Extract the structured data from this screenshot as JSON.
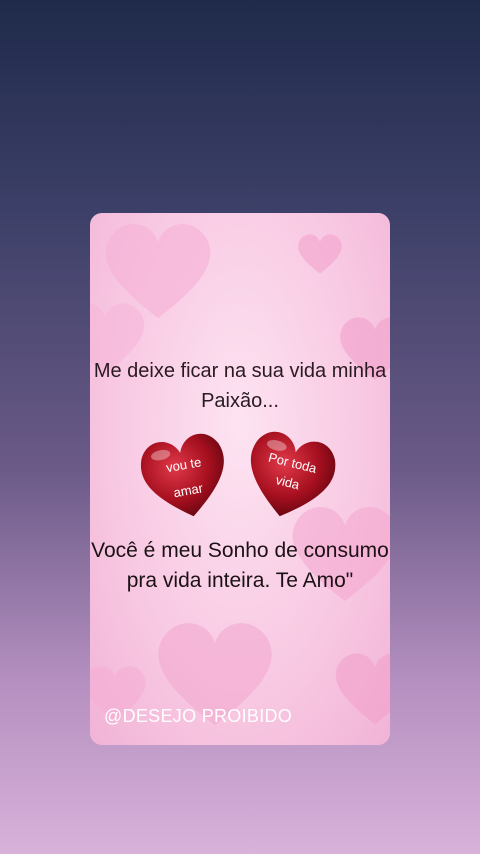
{
  "text": {
    "line1": "Me deixe ficar na sua vida minha Paixão...",
    "line2": "Você é meu Sonho de consumo pra vida inteira. Te Amo\"",
    "signature": "@DESEJO PROIBIDO"
  },
  "hearts": [
    {
      "label_line1": "vou te",
      "label_line2": "amar",
      "color": "#a50f1e"
    },
    {
      "label_line1": "Por toda",
      "label_line2": "vida",
      "color": "#a50f1e"
    }
  ],
  "colors": {
    "card_bg": "#f8c8e2",
    "bg_heart": "#f5a9cf",
    "heart_red": "#a50f1e"
  }
}
